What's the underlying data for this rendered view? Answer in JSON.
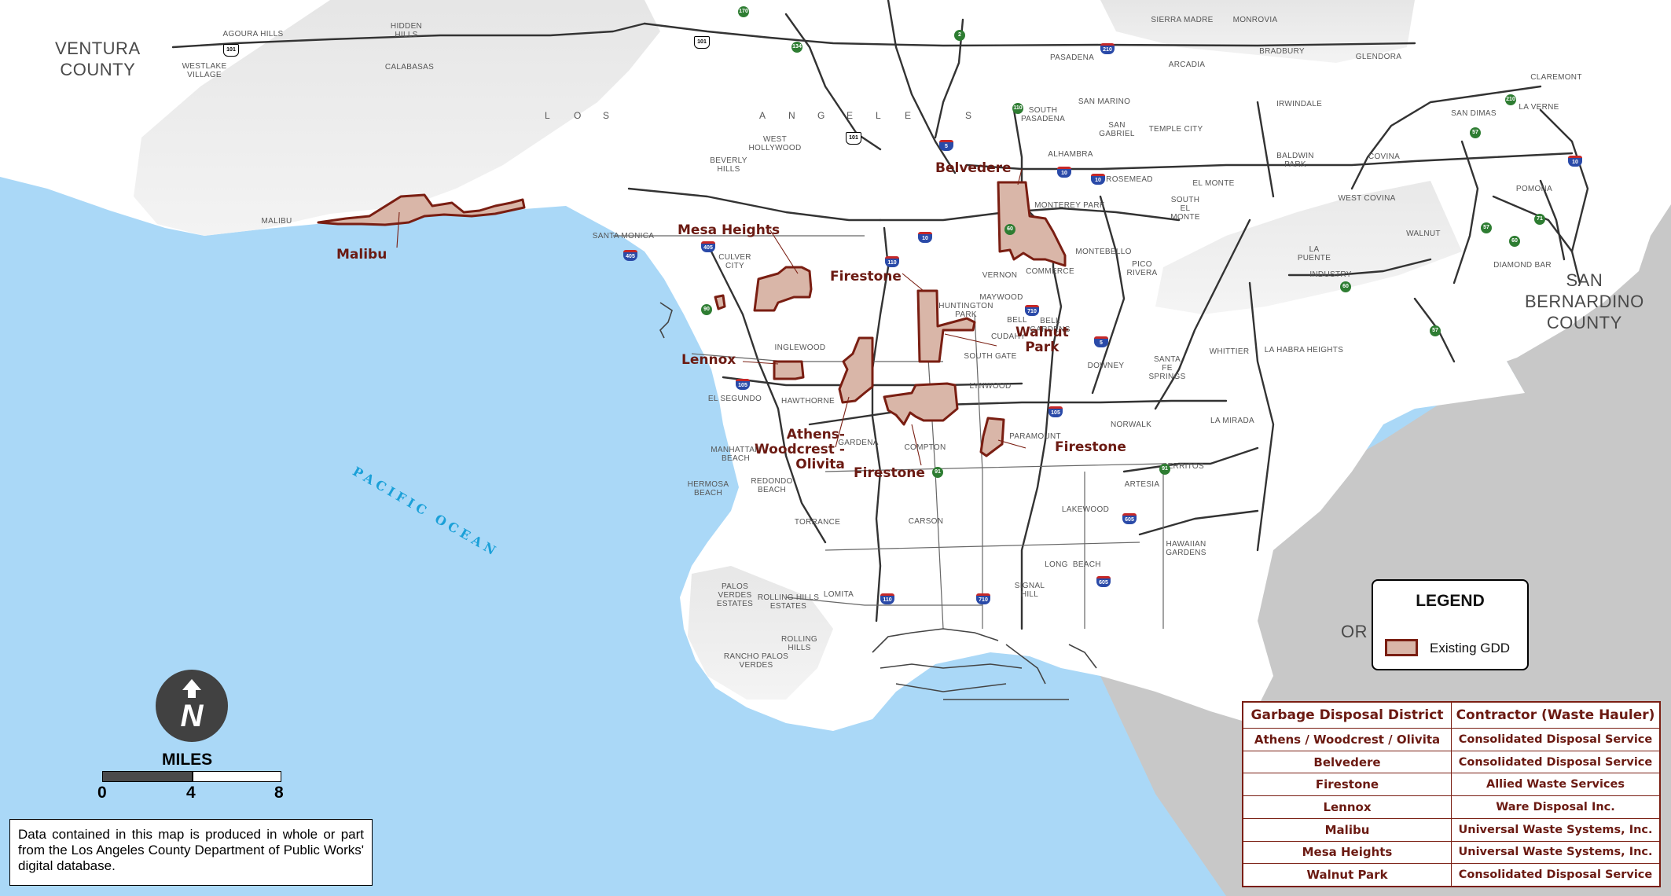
{
  "counties": {
    "ventura": "VENTURA\nCOUNTY",
    "san_bernardino": "SAN\nBERNARDINO\nCOUNTY",
    "orange_partial": "OR"
  },
  "ocean": "PACIFIC  OCEAN",
  "los_angeles_letters": [
    "L",
    "O",
    "S",
    "A",
    "N",
    "G",
    "E",
    "L",
    "E",
    "S"
  ],
  "cities": [
    {
      "id": "agoura-hills",
      "t": "AGOURA HILLS"
    },
    {
      "id": "hidden-hills",
      "t": "HIDDEN\nHILLS"
    },
    {
      "id": "westlake-village",
      "t": "WESTLAKE\nVILLAGE"
    },
    {
      "id": "calabasas",
      "t": "CALABASAS"
    },
    {
      "id": "malibu-city",
      "t": "MALIBU"
    },
    {
      "id": "santa-monica",
      "t": "SANTA MONICA"
    },
    {
      "id": "west-hollywood",
      "t": "WEST\nHOLLYWOOD"
    },
    {
      "id": "beverly-hills",
      "t": "BEVERLY\nHILLS"
    },
    {
      "id": "culver-city",
      "t": "CULVER\nCITY"
    },
    {
      "id": "inglewood",
      "t": "INGLEWOOD"
    },
    {
      "id": "el-segundo",
      "t": "EL SEGUNDO"
    },
    {
      "id": "hawthorne",
      "t": "HAWTHORNE"
    },
    {
      "id": "gardena",
      "t": "GARDENA"
    },
    {
      "id": "manhattan-beach",
      "t": "MANHATTAN\nBEACH"
    },
    {
      "id": "hermosa-beach",
      "t": "HERMOSA\nBEACH"
    },
    {
      "id": "redondo-beach",
      "t": "REDONDO\nBEACH"
    },
    {
      "id": "torrance",
      "t": "TORRANCE"
    },
    {
      "id": "palos-verdes-estates",
      "t": "PALOS\nVERDES\nESTATES"
    },
    {
      "id": "rolling-hills-estates",
      "t": "ROLLING HILLS\nESTATES"
    },
    {
      "id": "lomita",
      "t": "LOMITA"
    },
    {
      "id": "rolling-hills",
      "t": "ROLLING\nHILLS"
    },
    {
      "id": "rancho-palos-verdes",
      "t": "RANCHO PALOS\nVERDES"
    },
    {
      "id": "compton",
      "t": "COMPTON"
    },
    {
      "id": "carson",
      "t": "CARSON"
    },
    {
      "id": "lynwood",
      "t": "LYNWOOD"
    },
    {
      "id": "south-gate",
      "t": "SOUTH GATE"
    },
    {
      "id": "cudahy",
      "t": "CUDAHY"
    },
    {
      "id": "bell",
      "t": "BELL"
    },
    {
      "id": "bell-gardens",
      "t": "BELL\nGARDENS"
    },
    {
      "id": "maywood",
      "t": "MAYWOOD"
    },
    {
      "id": "huntington-park",
      "t": "HUNTINGTON\nPARK"
    },
    {
      "id": "vernon",
      "t": "VERNON"
    },
    {
      "id": "commerce",
      "t": "COMMERCE"
    },
    {
      "id": "montebello",
      "t": "MONTEBELLO"
    },
    {
      "id": "monterey-park",
      "t": "MONTEREY PARK"
    },
    {
      "id": "alhambra",
      "t": "ALHAMBRA"
    },
    {
      "id": "south-pasadena",
      "t": "SOUTH\nPASADENA"
    },
    {
      "id": "pasadena",
      "t": "PASADENA"
    },
    {
      "id": "san-marino",
      "t": "SAN MARINO"
    },
    {
      "id": "san-gabriel",
      "t": "SAN\nGABRIEL"
    },
    {
      "id": "temple-city",
      "t": "TEMPLE CITY"
    },
    {
      "id": "rosemead",
      "t": "ROSEMEAD"
    },
    {
      "id": "el-monte",
      "t": "EL MONTE"
    },
    {
      "id": "south-el-monte",
      "t": "SOUTH\nEL\nMONTE"
    },
    {
      "id": "pico-rivera",
      "t": "PICO\nRIVERA"
    },
    {
      "id": "downey",
      "t": "DOWNEY"
    },
    {
      "id": "paramount",
      "t": "PARAMOUNT"
    },
    {
      "id": "norwalk",
      "t": "NORWALK"
    },
    {
      "id": "santa-fe-springs",
      "t": "SANTA\nFE\nSPRINGS"
    },
    {
      "id": "whittier",
      "t": "WHITTIER"
    },
    {
      "id": "la-habra-heights",
      "t": "LA HABRA HEIGHTS"
    },
    {
      "id": "la-mirada",
      "t": "LA MIRADA"
    },
    {
      "id": "cerritos",
      "t": "CERRITOS"
    },
    {
      "id": "artesia",
      "t": "ARTESIA"
    },
    {
      "id": "lakewood",
      "t": "LAKEWOOD"
    },
    {
      "id": "hawaiian-gardens",
      "t": "HAWAIIAN\nGARDENS"
    },
    {
      "id": "long-beach",
      "t": "LONG  BEACH"
    },
    {
      "id": "signal-hill",
      "t": "SIGNAL\nHILL"
    },
    {
      "id": "sierra-madre",
      "t": "SIERRA MADRE"
    },
    {
      "id": "monrovia",
      "t": "MONROVIA"
    },
    {
      "id": "arcadia",
      "t": "ARCADIA"
    },
    {
      "id": "bradbury",
      "t": "BRADBURY"
    },
    {
      "id": "glendora",
      "t": "GLENDORA"
    },
    {
      "id": "claremont",
      "t": "CLAREMONT"
    },
    {
      "id": "la-verne",
      "t": "LA VERNE"
    },
    {
      "id": "san-dimas",
      "t": "SAN DIMAS"
    },
    {
      "id": "irwindale",
      "t": "IRWINDALE"
    },
    {
      "id": "baldwin-park",
      "t": "BALDWIN\nPARK"
    },
    {
      "id": "covina",
      "t": "COVINA"
    },
    {
      "id": "west-covina",
      "t": "WEST COVINA"
    },
    {
      "id": "pomona",
      "t": "POMONA"
    },
    {
      "id": "walnut",
      "t": "WALNUT"
    },
    {
      "id": "la-puente",
      "t": "LA\nPUENTE"
    },
    {
      "id": "industry",
      "t": "INDUSTRY"
    },
    {
      "id": "diamond-bar",
      "t": "DIAMOND BAR"
    }
  ],
  "shields": [
    {
      "t": "101",
      "k": "u"
    },
    {
      "t": "101",
      "k": "u"
    },
    {
      "t": "101",
      "k": "u"
    },
    {
      "t": "170",
      "k": "s"
    },
    {
      "t": "134",
      "k": "s"
    },
    {
      "t": "2",
      "k": "s"
    },
    {
      "t": "210",
      "k": "i"
    },
    {
      "t": "110",
      "k": "s"
    },
    {
      "t": "5",
      "k": "i"
    },
    {
      "t": "10",
      "k": "i"
    },
    {
      "t": "10",
      "k": "i"
    },
    {
      "t": "10",
      "k": "i"
    },
    {
      "t": "60",
      "k": "s"
    },
    {
      "t": "405",
      "k": "i"
    },
    {
      "t": "110",
      "k": "i"
    },
    {
      "t": "710",
      "k": "i"
    },
    {
      "t": "5",
      "k": "i"
    },
    {
      "t": "105",
      "k": "i"
    },
    {
      "t": "105",
      "k": "i"
    },
    {
      "t": "90",
      "k": "s"
    },
    {
      "t": "91",
      "k": "s"
    },
    {
      "t": "91",
      "k": "s"
    },
    {
      "t": "605",
      "k": "i"
    },
    {
      "t": "605",
      "k": "i"
    },
    {
      "t": "405",
      "k": "i"
    },
    {
      "t": "110",
      "k": "i"
    },
    {
      "t": "710",
      "k": "i"
    },
    {
      "t": "210",
      "k": "s"
    },
    {
      "t": "57",
      "k": "s"
    },
    {
      "t": "71",
      "k": "s"
    },
    {
      "t": "57",
      "k": "s"
    },
    {
      "t": "60",
      "k": "s"
    },
    {
      "t": "60",
      "k": "s"
    },
    {
      "t": "57",
      "k": "s"
    },
    {
      "t": "10",
      "k": "i"
    }
  ],
  "gdd_labels": {
    "belvedere": "Belvedere",
    "malibu": "Malibu",
    "mesa_heights": "Mesa Heights",
    "firestone_n": "Firestone",
    "walnut_park": "Walnut\nPark",
    "lennox": "Lennox",
    "athens": "Athens-\nWoodcrest -\nOlivita",
    "firestone_s": "Firestone",
    "firestone_e": "Firestone"
  },
  "legend": {
    "title": "LEGEND",
    "item": "Existing GDD"
  },
  "table": {
    "headers": [
      "Garbage Disposal District",
      "Contractor (Waste Hauler)"
    ],
    "rows": [
      [
        "Athens / Woodcrest / Olivita",
        "Consolidated Disposal Service"
      ],
      [
        "Belvedere",
        "Consolidated Disposal Service"
      ],
      [
        "Firestone",
        "Allied Waste Services"
      ],
      [
        "Lennox",
        "Ware Disposal Inc."
      ],
      [
        "Malibu",
        "Universal Waste Systems, Inc."
      ],
      [
        "Mesa Heights",
        "Universal Waste Systems, Inc."
      ],
      [
        "Walnut Park",
        "Consolidated Disposal Service"
      ]
    ]
  },
  "scale": {
    "title": "MILES",
    "ticks": [
      "0",
      "4",
      "8"
    ]
  },
  "north_letter": "N",
  "note": "Data contained in this map is produced in whole or part from the Los Angeles County Department of Public Works' digital database.",
  "colors": {
    "ocean": "#aad8f7",
    "land": "#ffffff",
    "neighbor": "#c8c8c8",
    "gdd_fill": "#d9b6a8",
    "gdd_stroke": "#7a1e12",
    "road": "#333333"
  }
}
